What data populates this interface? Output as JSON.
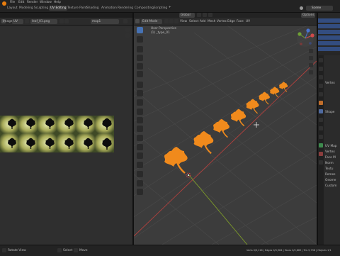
{
  "topbar": {
    "tabs": [
      "Layout",
      "Modeling",
      "Sculpting",
      "UV Editing",
      "Texture Paint",
      "Shading",
      "Animation",
      "Rendering",
      "Compositing",
      "Scripting"
    ],
    "active_tab": "UV Editing",
    "scene_label": "Scene"
  },
  "uv_editor": {
    "mode_label": "Image",
    "image_name": "leaf_01.png",
    "map_name": "map1",
    "uv_label": "UV"
  },
  "viewport": {
    "mode_label": "Edit Mode",
    "menus": [
      "View",
      "Select",
      "Add",
      "Mesh",
      "Vertex",
      "Edge",
      "Face",
      "UV"
    ],
    "orientation_label": "Global",
    "overlay_title": "User Perspective",
    "overlay_object": "(1) _type_01",
    "options_label": "Options"
  },
  "properties": {
    "sections": [
      "Vertex",
      "Shape",
      "UV Map",
      "Vertex",
      "Face M",
      "Norm",
      "Textu",
      "Remes",
      "Geome",
      "Custom"
    ]
  },
  "statusbar": {
    "left_hint": "Rotate View",
    "mid_hint": "Select",
    "mid_hint2": "Move",
    "stats": "Verts 0/3,116 | Edges 0/5,984 | Faces 0/2,869 | Tris 5,738 | Objects 1/1"
  },
  "colors": {
    "accent": "#4672b4",
    "leaf": "#f08a1c",
    "bg_dark": "#1d1d1d",
    "viewport": "#3c3c3c"
  }
}
